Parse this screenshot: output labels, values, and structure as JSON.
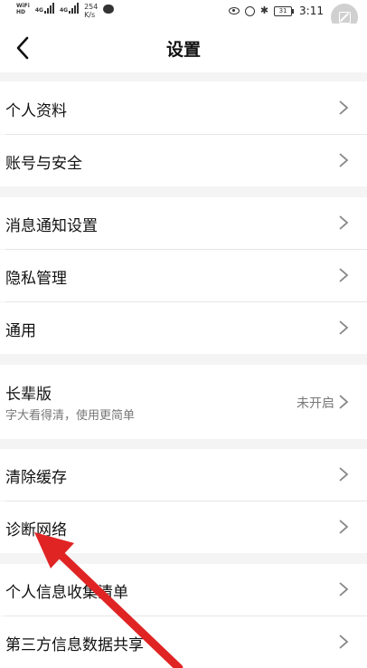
{
  "status_bar": {
    "network_tags": [
      "4G",
      "4G"
    ],
    "sim_tags": [
      "WiFi",
      "HD"
    ],
    "speed_value": "254",
    "speed_unit": "K/s",
    "battery": "31",
    "time": "3:11"
  },
  "header": {
    "title": "设置"
  },
  "rows": {
    "profile": {
      "label": "个人资料"
    },
    "account": {
      "label": "账号与安全"
    },
    "notify": {
      "label": "消息通知设置"
    },
    "privacy": {
      "label": "隐私管理"
    },
    "general": {
      "label": "通用"
    },
    "elder": {
      "label": "长辈版",
      "subtitle": "字大看得清，使用更简单",
      "value": "未开启"
    },
    "cache": {
      "label": "清除缓存"
    },
    "network": {
      "label": "诊断网络"
    },
    "info_list": {
      "label": "个人信息收集清单"
    },
    "third_party": {
      "label": "第三方信息数据共享"
    }
  },
  "annotation": {
    "arrow_color": "#e02424",
    "points_to": "诊断网络"
  }
}
